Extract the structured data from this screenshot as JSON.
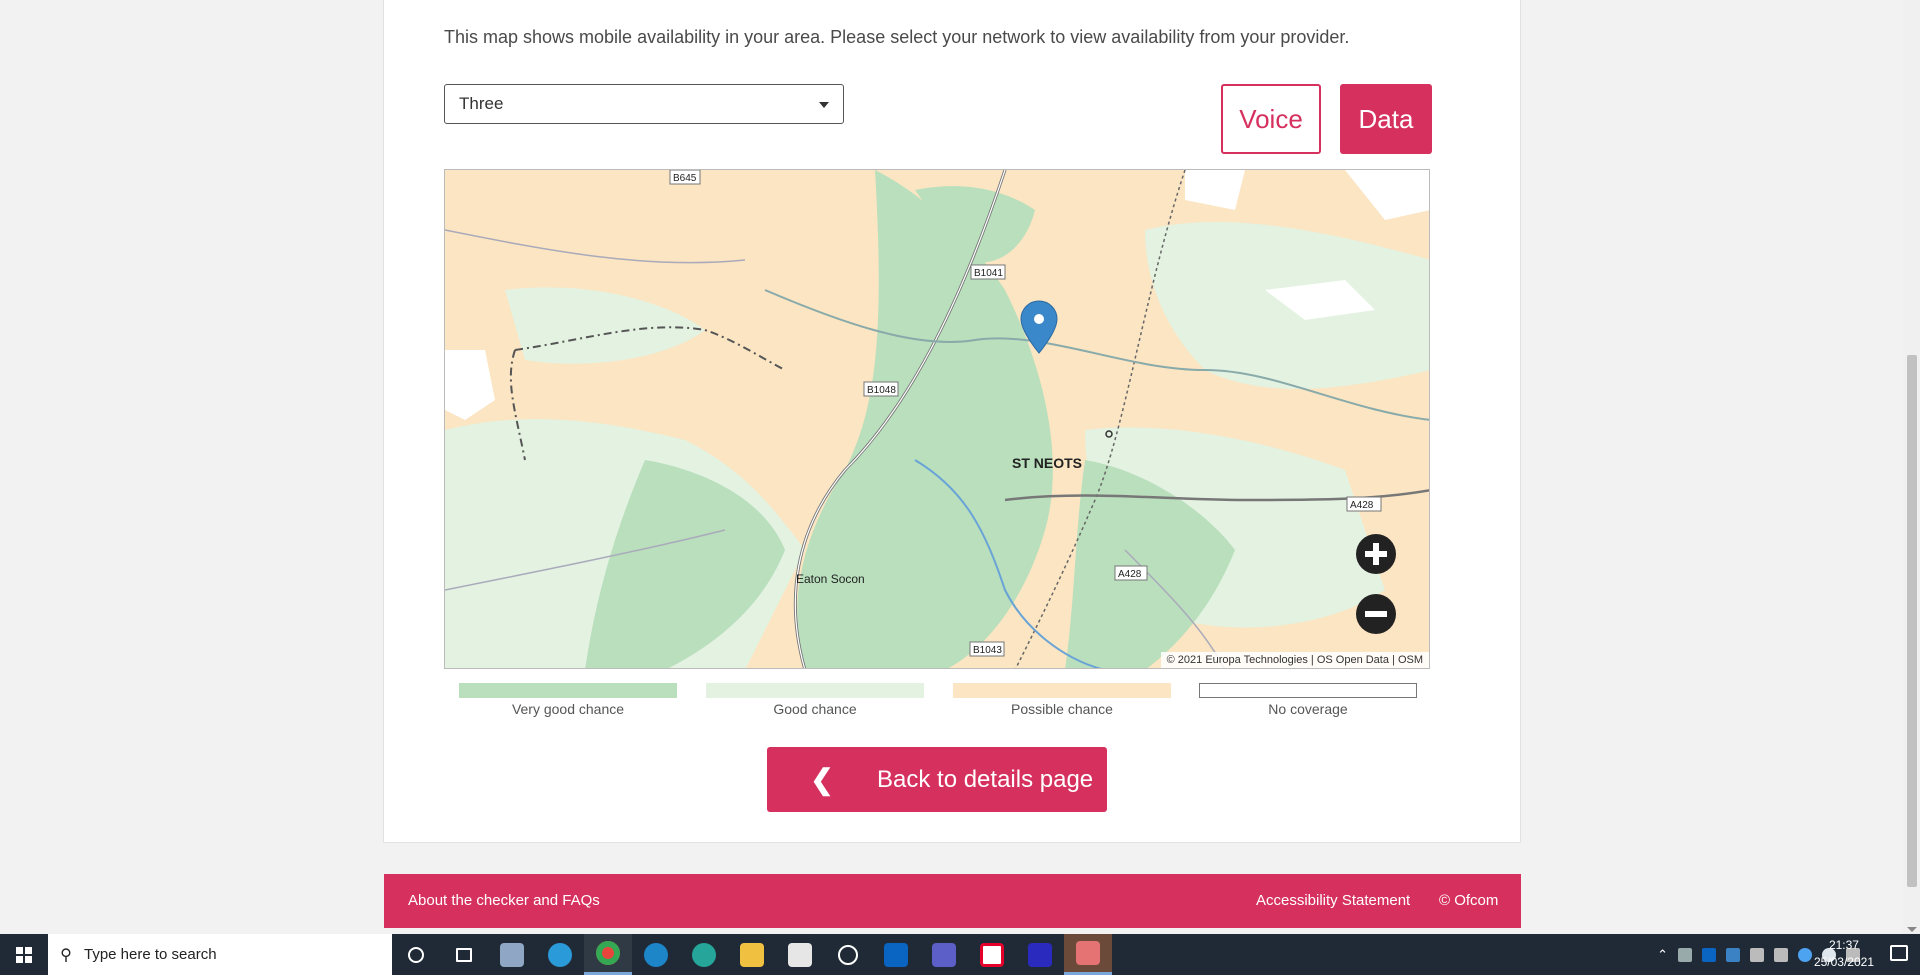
{
  "intro_text": "This map shows mobile availability in your area. Please select your network to view availability from your provider.",
  "network_select": {
    "value": "Three"
  },
  "mode_buttons": {
    "voice_label": "Voice",
    "data_label": "Data"
  },
  "map": {
    "labels": {
      "st_neots": "ST NEOTS",
      "eaton_socon": "Eaton Socon",
      "b645": "B645",
      "b1041": "B1041",
      "b1048": "B1048",
      "a428_east": "A428",
      "a428_south": "A428",
      "b1043": "B1043"
    },
    "attribution": "© 2021 Europa Technologies | OS Open Data | OSM",
    "marker_icon": "location-pin-icon",
    "colors": {
      "very_good": "#b9dfbd",
      "good": "#e3f2e1",
      "possible": "#fbe5c2",
      "none": "#ffffff"
    }
  },
  "legend": [
    {
      "label": "Very good chance",
      "color": "#b9dfbd"
    },
    {
      "label": "Good chance",
      "color": "#e3f2e1"
    },
    {
      "label": "Possible chance",
      "color": "#fbe5c2"
    },
    {
      "label": "No coverage",
      "color": "#ffffff"
    }
  ],
  "back_button": {
    "label": "Back to details page",
    "icon": "chevron-left-icon"
  },
  "footer": {
    "faq_link": "About the checker and FAQs",
    "accessibility_link": "Accessibility Statement",
    "copyright": "© Ofcom"
  },
  "taskbar": {
    "search_placeholder": "Type here to search",
    "clock_time": "21:37",
    "clock_date": "25/03/2021",
    "accent": "#d6305e"
  }
}
